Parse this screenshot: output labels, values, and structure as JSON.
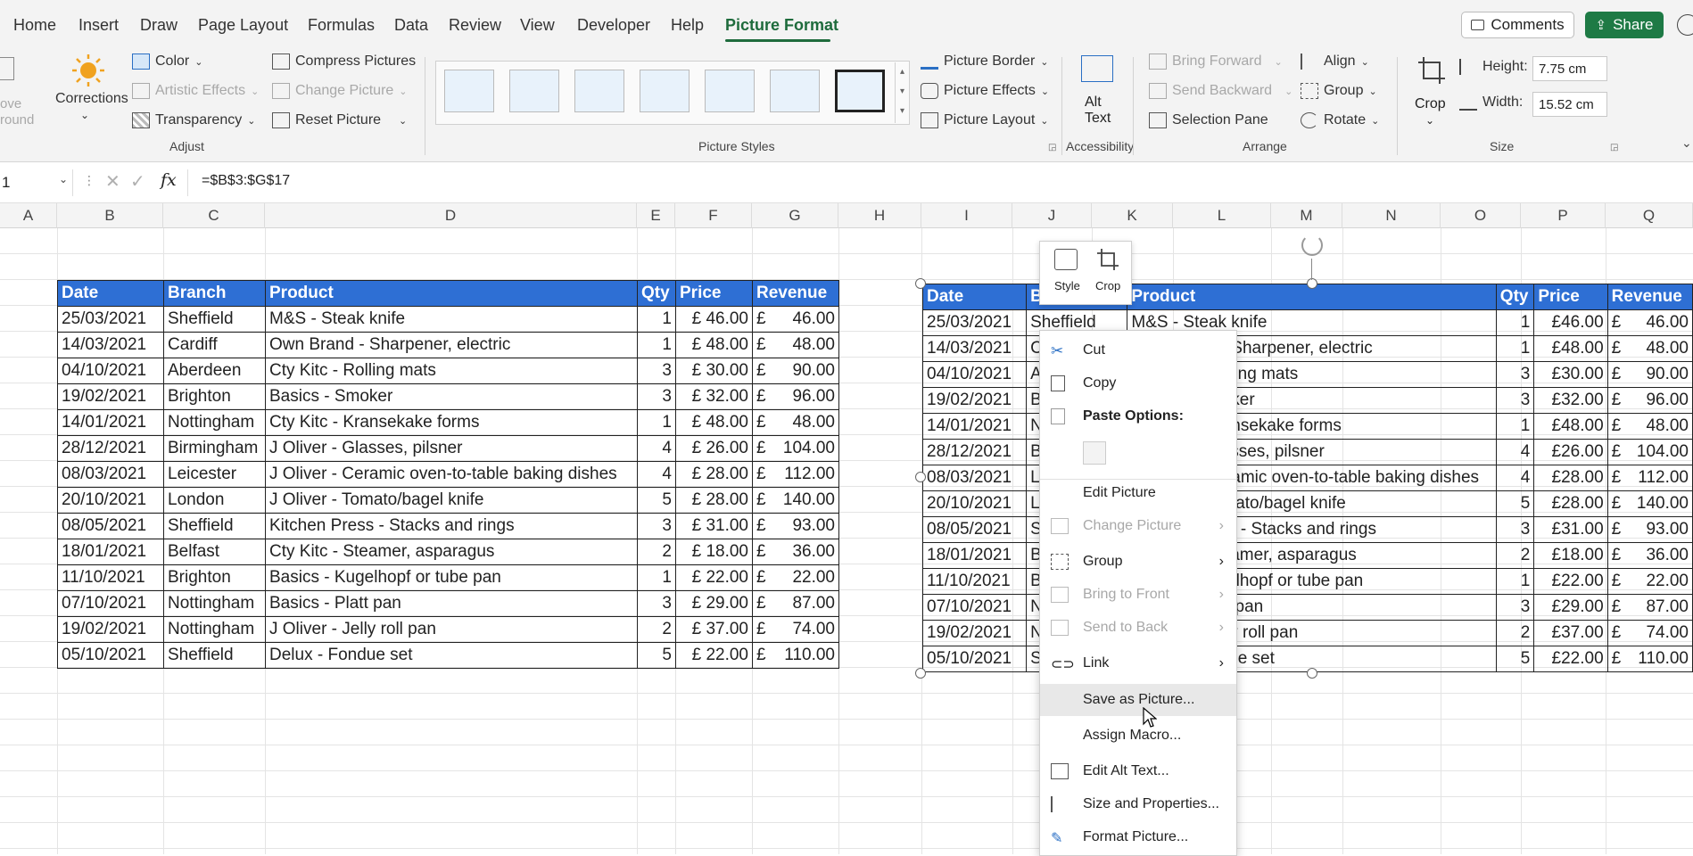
{
  "tabs": {
    "items": [
      "Home",
      "Insert",
      "Draw",
      "Page Layout",
      "Formulas",
      "Data",
      "Review",
      "View",
      "Developer",
      "Help",
      "Picture Format"
    ],
    "active": "Picture Format",
    "comments_label": "Comments",
    "share_label": "Share"
  },
  "ribbon": {
    "remove_bg_partial": [
      "ove",
      "round"
    ],
    "corrections_label": "Corrections",
    "color_label": "Color",
    "artistic_effects_label": "Artistic Effects",
    "transparency_label": "Transparency",
    "compress_label": "Compress Pictures",
    "change_picture_label": "Change Picture",
    "reset_picture_label": "Reset Picture",
    "adjust_group": "Adjust",
    "picture_styles_group": "Picture Styles",
    "picture_border_label": "Picture Border",
    "picture_effects_label": "Picture Effects",
    "picture_layout_label": "Picture Layout",
    "alt_text_label": "Alt Text",
    "accessibility_group": "Accessibility",
    "bring_forward_label": "Bring Forward",
    "send_backward_label": "Send Backward",
    "selection_pane_label": "Selection Pane",
    "align_label": "Align",
    "group_label": "Group",
    "rotate_label": "Rotate",
    "arrange_group": "Arrange",
    "crop_label": "Crop",
    "height_label": "Height:",
    "height_value": "7.75 cm",
    "width_label": "Width:",
    "width_value": "15.52 cm",
    "size_group": "Size"
  },
  "formula_bar": {
    "name_box": "1",
    "fx": "fx",
    "formula": "=$B$3:$G$17"
  },
  "columns": [
    "A",
    "B",
    "C",
    "D",
    "E",
    "F",
    "G",
    "H",
    "I",
    "J",
    "K",
    "L",
    "M",
    "N",
    "O",
    "P",
    "Q"
  ],
  "table": {
    "headers": [
      "Date",
      "Branch",
      "Product",
      "Qty",
      "Price",
      "Revenue"
    ],
    "rows": [
      [
        "25/03/2021",
        "Sheffield",
        "M&S - Steak knife",
        "1",
        "£ 46.00",
        "£",
        "46.00"
      ],
      [
        "14/03/2021",
        "Cardiff",
        "Own Brand - Sharpener, electric",
        "1",
        "£ 48.00",
        "£",
        "48.00"
      ],
      [
        "04/10/2021",
        "Aberdeen",
        "Cty Kitc - Rolling mats",
        "3",
        "£ 30.00",
        "£",
        "90.00"
      ],
      [
        "19/02/2021",
        "Brighton",
        "Basics - Smoker",
        "3",
        "£ 32.00",
        "£",
        "96.00"
      ],
      [
        "14/01/2021",
        "Nottingham",
        "Cty Kitc - Kransekake forms",
        "1",
        "£ 48.00",
        "£",
        "48.00"
      ],
      [
        "28/12/2021",
        "Birmingham",
        "J Oliver - Glasses, pilsner",
        "4",
        "£ 26.00",
        "£",
        "104.00"
      ],
      [
        "08/03/2021",
        "Leicester",
        "J Oliver - Ceramic oven-to-table baking dishes",
        "4",
        "£ 28.00",
        "£",
        "112.00"
      ],
      [
        "20/10/2021",
        "London",
        "J Oliver - Tomato/bagel knife",
        "5",
        "£ 28.00",
        "£",
        "140.00"
      ],
      [
        "08/05/2021",
        "Sheffield",
        "Kitchen Press - Stacks and rings",
        "3",
        "£ 31.00",
        "£",
        "93.00"
      ],
      [
        "18/01/2021",
        "Belfast",
        "Cty Kitc - Steamer, asparagus",
        "2",
        "£ 18.00",
        "£",
        "36.00"
      ],
      [
        "11/10/2021",
        "Brighton",
        "Basics - Kugelhopf or tube pan",
        "1",
        "£ 22.00",
        "£",
        "22.00"
      ],
      [
        "07/10/2021",
        "Nottingham",
        "Basics - Platt pan",
        "3",
        "£ 29.00",
        "£",
        "87.00"
      ],
      [
        "19/02/2021",
        "Nottingham",
        "J Oliver - Jelly roll pan",
        "2",
        "£ 37.00",
        "£",
        "74.00"
      ],
      [
        "05/10/2021",
        "Sheffield",
        "Delux - Fondue set",
        "5",
        "£ 22.00",
        "£",
        "110.00"
      ]
    ]
  },
  "picture_table": {
    "prices": [
      "£46.00",
      "£48.00",
      "£30.00",
      "£32.00",
      "£48.00",
      "£26.00",
      "£28.00",
      "£28.00",
      "£31.00",
      "£18.00",
      "£22.00",
      "£29.00",
      "£37.00",
      "£22.00"
    ],
    "first_row_branch": "Sheffield",
    "first_row_product": "M&S - Steak knife",
    "product_tails": [
      "M&S - Steak knife",
      "Sharpener, electric",
      "ing mats",
      "ter",
      "nsekake forms",
      "ses, pilsner",
      "amic oven-to-table baking dishes",
      "ato/bagel knife",
      "- Stacks and rings",
      "amer, asparagus",
      "hopf or tube pan",
      "pan",
      "roll pan",
      "e set"
    ],
    "branch_initials": [
      "Sheffield",
      "C",
      "A",
      "B",
      "N",
      "B",
      "L",
      "L",
      "S",
      "B",
      "B",
      "N",
      "N",
      "S"
    ]
  },
  "mini_toolbar": {
    "style_label": "Style",
    "crop_label": "Crop"
  },
  "context_menu": {
    "cut": "Cut",
    "copy": "Copy",
    "paste_options": "Paste Options:",
    "edit_picture": "Edit Picture",
    "change_picture": "Change Picture",
    "group": "Group",
    "bring_to_front": "Bring to Front",
    "send_to_back": "Send to Back",
    "link": "Link",
    "save_as_picture": "Save as Picture...",
    "assign_macro": "Assign Macro...",
    "edit_alt_text": "Edit Alt Text...",
    "size_and_properties": "Size and Properties...",
    "format_picture": "Format Picture..."
  },
  "colors": {
    "accent_green": "#1e6b3c",
    "header_blue": "#2e6fd4",
    "ribbon_bg": "#f3f3f3"
  }
}
